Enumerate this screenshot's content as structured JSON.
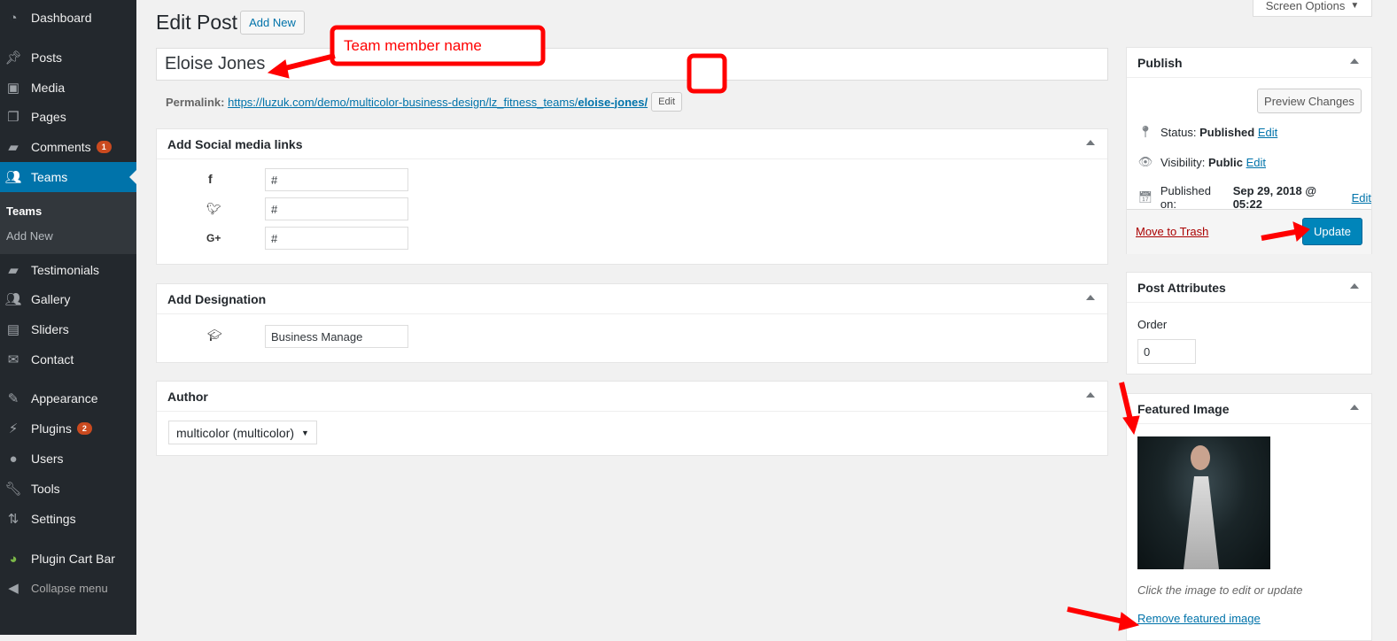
{
  "sidebar": {
    "items": [
      {
        "label": "Dashboard",
        "icon": "dashboard-icon"
      },
      {
        "label": "Posts",
        "icon": "pin-icon"
      },
      {
        "label": "Media",
        "icon": "media-icon"
      },
      {
        "label": "Pages",
        "icon": "pages-icon"
      },
      {
        "label": "Comments",
        "icon": "comment-icon",
        "badge": "1"
      },
      {
        "label": "Teams",
        "icon": "groups-icon",
        "active": true
      },
      {
        "label": "Testimonials",
        "icon": "testimonial-icon"
      },
      {
        "label": "Gallery",
        "icon": "groups-icon"
      },
      {
        "label": "Sliders",
        "icon": "slides-icon"
      },
      {
        "label": "Contact",
        "icon": "email-icon"
      },
      {
        "label": "Appearance",
        "icon": "brush-icon"
      },
      {
        "label": "Plugins",
        "icon": "plugin-icon",
        "badge": "2"
      },
      {
        "label": "Users",
        "icon": "user-icon"
      },
      {
        "label": "Tools",
        "icon": "wrench-icon"
      },
      {
        "label": "Settings",
        "icon": "settings-icon"
      },
      {
        "label": "Plugin Cart Bar",
        "icon": "cart-bar-icon"
      },
      {
        "label": "Collapse menu",
        "icon": "collapse-icon"
      }
    ],
    "submenu": [
      "Teams",
      "Add New"
    ]
  },
  "header": {
    "title": "Edit Post",
    "add_new": "Add New",
    "screen_options": "Screen Options"
  },
  "post": {
    "title": "Eloise Jones",
    "permalink_label": "Permalink:",
    "permalink_url": "https://luzuk.com/demo/multicolor-business-design/lz_fitness_teams/",
    "permalink_slug": "eloise-jones/",
    "permalink_edit": "Edit"
  },
  "social": {
    "title": "Add Social media links",
    "rows": [
      {
        "icon": "facebook-icon",
        "value": "#"
      },
      {
        "icon": "twitter-icon",
        "value": "#"
      },
      {
        "icon": "google-plus-icon",
        "value": "#"
      }
    ]
  },
  "designation": {
    "title": "Add Designation",
    "value": "Business Manage"
  },
  "author": {
    "title": "Author",
    "selected": "multicolor (multicolor)"
  },
  "publish": {
    "title": "Publish",
    "preview": "Preview Changes",
    "status_label": "Status:",
    "status": "Published",
    "visibility_label": "Visibility:",
    "visibility": "Public",
    "published_label": "Published on:",
    "published": "Sep 29, 2018 @ 05:22",
    "edit": "Edit",
    "trash": "Move to Trash",
    "update": "Update"
  },
  "attributes": {
    "title": "Post Attributes",
    "order_label": "Order",
    "order": "0"
  },
  "featured": {
    "title": "Featured Image",
    "hint": "Click the image to edit or update",
    "remove": "Remove featured image"
  },
  "annotation": {
    "label": "Team member name",
    "color": "#ff0000"
  }
}
